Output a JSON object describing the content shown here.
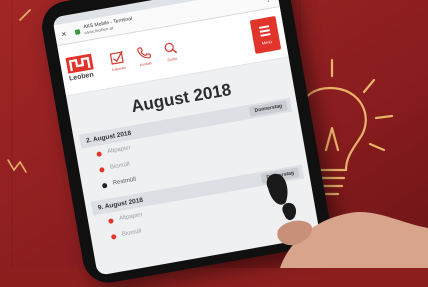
{
  "browser": {
    "tab_title": "AKS Mobile - Terminal",
    "url": "www.leoben.at",
    "close_glyph": "×",
    "menu_glyph": "⋮"
  },
  "app": {
    "logo_text": "Leoben",
    "nav_items": [
      {
        "icon": "checkbox-icon",
        "label": "Kalender"
      },
      {
        "icon": "phone-icon",
        "label": "Kontakt"
      },
      {
        "icon": "search-icon",
        "label": "Suche"
      }
    ],
    "menu_label": "Menü",
    "accent_color": "#e3342b"
  },
  "calendar": {
    "month_title": "August 2018",
    "days": [
      {
        "date": "2. August 2018",
        "weekday": "Donnerstag",
        "entries": [
          {
            "label": "Altpapier",
            "dot": "red"
          },
          {
            "label": "Biomüll",
            "dot": "red"
          },
          {
            "label": "Restmüll",
            "dot": "dark"
          }
        ]
      },
      {
        "date": "9. August 2018",
        "weekday": "Donnerstag",
        "entries": [
          {
            "label": "Altpapier",
            "dot": "red"
          },
          {
            "label": "Biomüll",
            "dot": "red"
          }
        ]
      }
    ]
  }
}
